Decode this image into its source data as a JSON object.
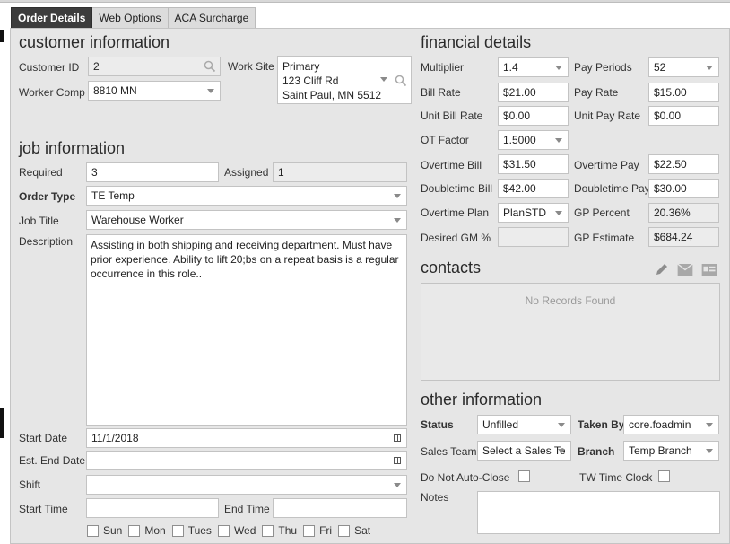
{
  "tabs": [
    {
      "label": "Order Details",
      "active": true
    },
    {
      "label": "Web Options",
      "active": false
    },
    {
      "label": "ACA Surcharge",
      "active": false
    }
  ],
  "customer": {
    "heading": "customer information",
    "customer_id_label": "Customer ID",
    "customer_id": "2",
    "worker_comp_label": "Worker Comp",
    "worker_comp": "8810 MN",
    "work_site_label": "Work Site",
    "work_site_lines": [
      "Primary",
      "123 Cliff Rd",
      "Saint Paul, MN 5512"
    ]
  },
  "job": {
    "heading": "job information",
    "required_label": "Required",
    "required": "3",
    "assigned_label": "Assigned",
    "assigned": "1",
    "order_type_label": "Order Type",
    "order_type": "TE  Temp",
    "job_title_label": "Job Title",
    "job_title": "Warehouse Worker",
    "description_label": "Description",
    "description": "Assisting in both shipping and receiving department. Must have prior experience. Ability to lift 20;bs on a repeat basis is a regular occurrence in this role..",
    "start_date_label": "Start Date",
    "start_date": "11/1/2018",
    "end_date_label": "Est. End Date",
    "end_date": "",
    "shift_label": "Shift",
    "shift": "",
    "start_time_label": "Start Time",
    "start_time": "",
    "end_time_label": "End Time",
    "end_time": "",
    "days": [
      "Sun",
      "Mon",
      "Tues",
      "Wed",
      "Thu",
      "Fri",
      "Sat"
    ]
  },
  "financial": {
    "heading": "financial details",
    "multiplier_label": "Multiplier",
    "multiplier": "1.4",
    "pay_periods_label": "Pay Periods",
    "pay_periods": "52",
    "bill_rate_label": "Bill Rate",
    "bill_rate": "$21.00",
    "pay_rate_label": "Pay Rate",
    "pay_rate": "$15.00",
    "unit_bill_rate_label": "Unit Bill Rate",
    "unit_bill_rate": "$0.00",
    "unit_pay_rate_label": "Unit Pay Rate",
    "unit_pay_rate": "$0.00",
    "ot_factor_label": "OT Factor",
    "ot_factor": "1.5000",
    "overtime_bill_label": "Overtime Bill",
    "overtime_bill": "$31.50",
    "overtime_pay_label": "Overtime Pay",
    "overtime_pay": "$22.50",
    "doubletime_bill_label": "Doubletime Bill",
    "doubletime_bill": "$42.00",
    "doubletime_pay_label": "Doubletime Pay",
    "doubletime_pay": "$30.00",
    "overtime_plan_label": "Overtime Plan",
    "overtime_plan": "PlanSTD",
    "gp_percent_label": "GP Percent",
    "gp_percent": "20.36%",
    "desired_gm_label": "Desired GM %",
    "desired_gm": "",
    "gp_estimate_label": "GP Estimate",
    "gp_estimate": "$684.24"
  },
  "contacts": {
    "heading": "contacts",
    "empty_text": "No Records Found"
  },
  "other": {
    "heading": "other information",
    "status_label": "Status",
    "status": "Unfilled",
    "taken_by_label": "Taken By",
    "taken_by": "core.foadmin",
    "sales_team_label": "Sales Team",
    "sales_team": "Select a Sales Te",
    "branch_label": "Branch",
    "branch": "Temp Branch",
    "do_not_auto_close_label": "Do Not Auto-Close",
    "tw_time_clock_label": "TW Time Clock",
    "notes_label": "Notes",
    "notes": ""
  }
}
